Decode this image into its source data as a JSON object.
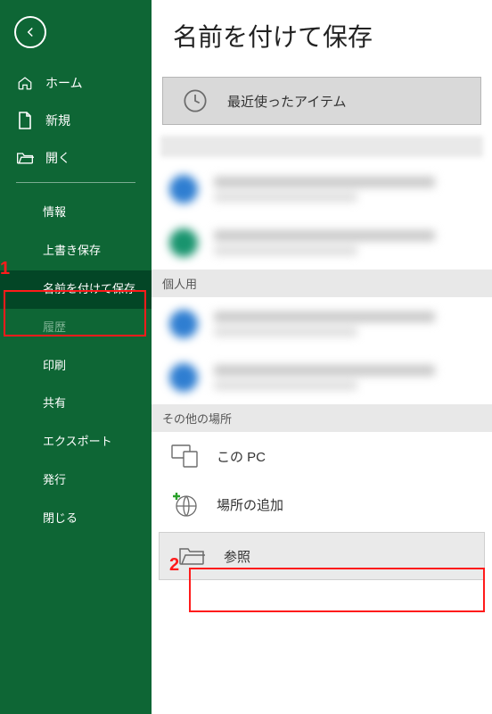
{
  "title": "名前を付けて保存",
  "sidebar": {
    "top": [
      {
        "label": "ホーム",
        "icon": "home-icon"
      },
      {
        "label": "新規",
        "icon": "new-file-icon"
      },
      {
        "label": "開く",
        "icon": "open-folder-icon"
      }
    ],
    "sub": [
      {
        "label": "情報"
      },
      {
        "label": "上書き保存"
      },
      {
        "label": "名前を付けて保存",
        "active": true
      },
      {
        "label": "履歴",
        "disabled": true
      },
      {
        "label": "印刷"
      },
      {
        "label": "共有"
      },
      {
        "label": "エクスポート"
      },
      {
        "label": "発行"
      },
      {
        "label": "閉じる"
      }
    ]
  },
  "main": {
    "recent": {
      "label": "最近使ったアイテム"
    },
    "sections": {
      "personal": "個人用",
      "other": "その他の場所"
    },
    "otherItems": [
      {
        "label": "この PC",
        "icon": "this-pc-icon"
      },
      {
        "label": "場所の追加",
        "icon": "add-place-icon"
      },
      {
        "label": "参照",
        "icon": "browse-folder-icon"
      }
    ]
  },
  "annotations": {
    "one": "1",
    "two": "2"
  },
  "colors": {
    "brand": "#0e6635"
  }
}
